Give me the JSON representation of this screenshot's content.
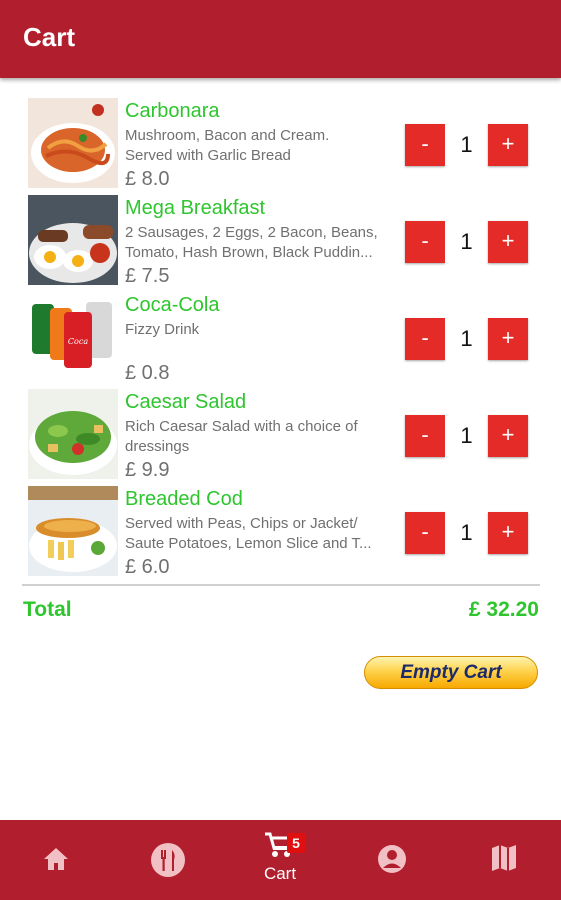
{
  "appbar": {
    "title": "Cart"
  },
  "cart": {
    "items": [
      {
        "name": "Carbonara",
        "desc_lines": [
          "Mushroom, Bacon and Cream.",
          "Served with Garlic Bread"
        ],
        "price": "£ 8.0",
        "qty": "1"
      },
      {
        "name": "Mega Breakfast",
        "desc_lines": [
          "2 Sausages, 2 Eggs, 2 Bacon, Beans,",
          "Tomato, Hash Brown, Black Puddin..."
        ],
        "price": "£ 7.5",
        "qty": "1"
      },
      {
        "name": "Coca-Cola",
        "desc_lines": [
          "Fizzy Drink",
          ""
        ],
        "price": "£ 0.8",
        "qty": "1"
      },
      {
        "name": "Caesar Salad",
        "desc_lines": [
          "Rich Caesar Salad with a choice of",
          "dressings"
        ],
        "price": "£ 9.9",
        "qty": "1"
      },
      {
        "name": "Breaded Cod",
        "desc_lines": [
          "Served with Peas, Chips or Jacket/",
          "Saute Potatoes, Lemon Slice and T..."
        ],
        "price": "£ 6.0",
        "qty": "1"
      }
    ],
    "minus_label": "-",
    "plus_label": "+",
    "total_label": "Total",
    "total_value": "£ 32.20",
    "empty_cart_label": "Empty Cart"
  },
  "bottom_nav": {
    "items": [
      {
        "icon": "home-icon"
      },
      {
        "icon": "restaurant-icon"
      },
      {
        "icon": "cart-icon",
        "label": "Cart",
        "badge": "5"
      },
      {
        "icon": "account-icon"
      },
      {
        "icon": "map-icon"
      }
    ]
  },
  "colors": {
    "brand": "#b11f2e",
    "accent_green": "#2ec52e",
    "button_red": "#e52b27"
  }
}
